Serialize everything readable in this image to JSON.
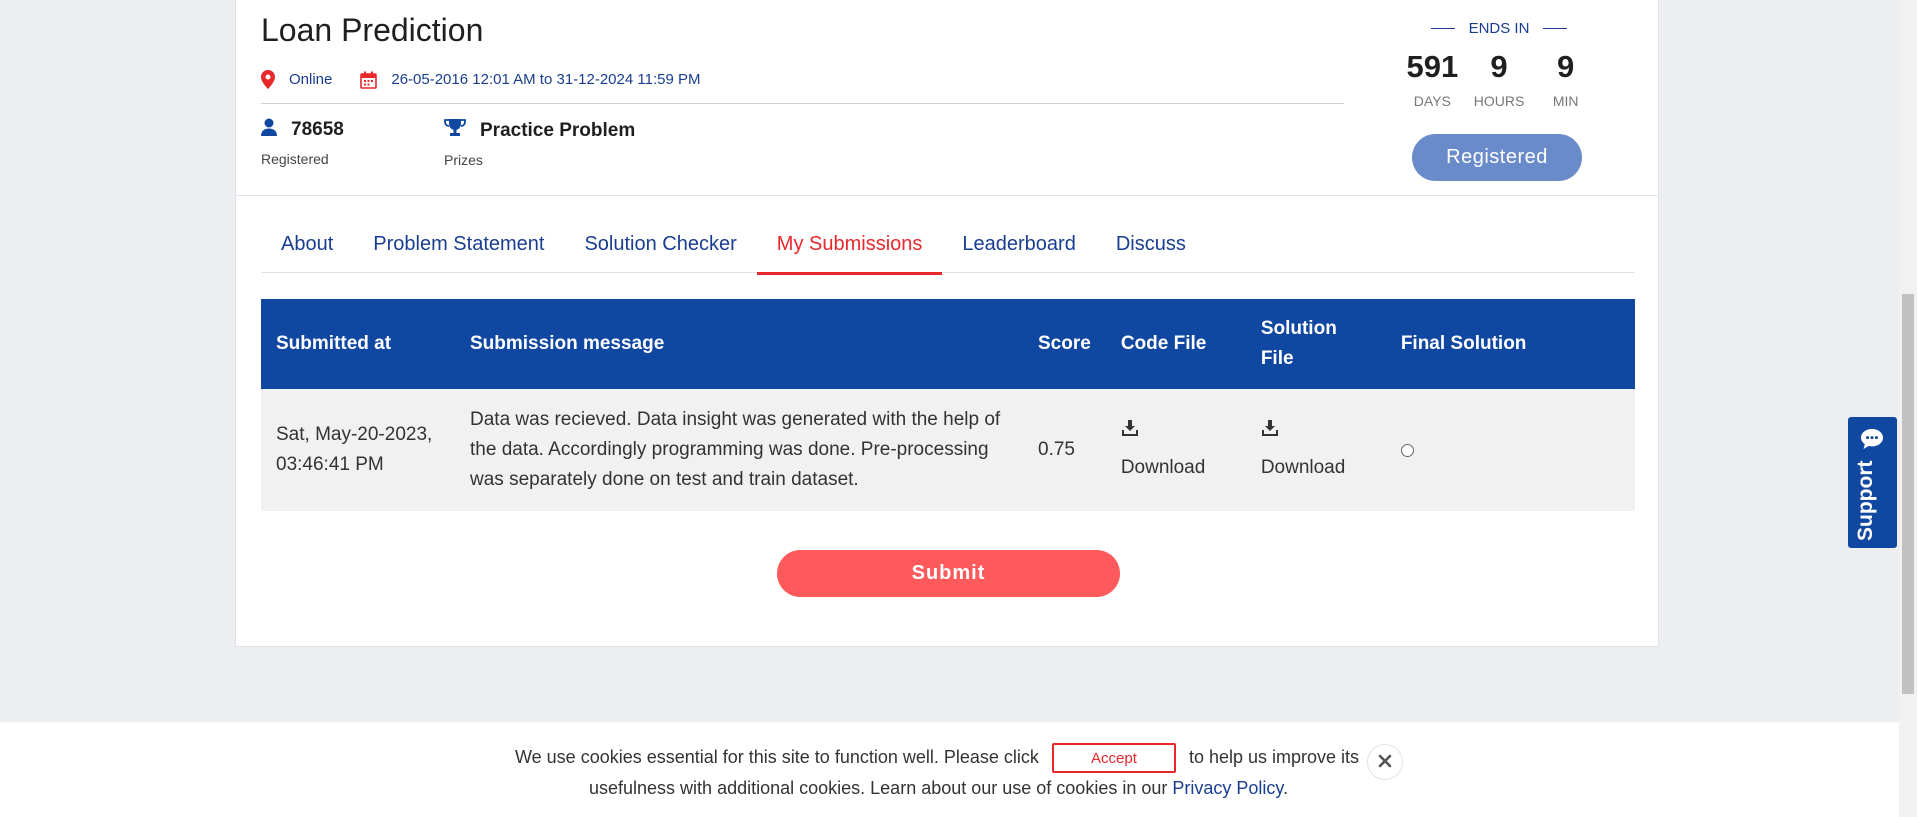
{
  "contest": {
    "title": "Loan Prediction",
    "location": "Online",
    "date_range": "26-05-2016 12:01 AM to 31-12-2024 11:59 PM",
    "registered_count": "78658",
    "registered_label": "Registered",
    "prize_value": "Practice Problem",
    "prize_label": "Prizes"
  },
  "countdown": {
    "heading": "ENDS IN",
    "days": "591",
    "days_label": "DAYS",
    "hours": "9",
    "hours_label": "HOURS",
    "minutes": "9",
    "minutes_label": "MIN",
    "button_label": "Registered"
  },
  "tabs": [
    {
      "label": "About",
      "active": false
    },
    {
      "label": "Problem Statement",
      "active": false
    },
    {
      "label": "Solution Checker",
      "active": false
    },
    {
      "label": "My Submissions",
      "active": true
    },
    {
      "label": "Leaderboard",
      "active": false
    },
    {
      "label": "Discuss",
      "active": false
    }
  ],
  "submissions": {
    "headers": [
      "Submitted at",
      "Submission message",
      "Score",
      "Code File",
      "Solution File",
      "Final Solution"
    ],
    "rows": [
      {
        "submitted_at": "Sat, May-20-2023, 03:46:41 PM",
        "message": "Data was recieved. Data insight was generated with the help of the data. Accordingly programming was done. Pre-processing was separately done on test and train dataset.",
        "score": "0.75",
        "code_file": "Download",
        "solution_file": "Download",
        "final_solution_selected": false
      }
    ]
  },
  "submit_label": "Submit",
  "support_label": "Support",
  "cookie": {
    "text_before": "We use cookies essential for this site to function well. Please click",
    "accept_label": "Accept",
    "text_after": "to help us improve its",
    "text_line2": "usefulness with additional cookies. Learn about our use of cookies in our",
    "privacy_link": "Privacy Policy",
    "period": "."
  },
  "colors": {
    "primary": "#0f47a1",
    "accent_red": "#e8282b",
    "submit_bg": "#fe5a5b",
    "registered_btn": "#6a8bc9"
  }
}
